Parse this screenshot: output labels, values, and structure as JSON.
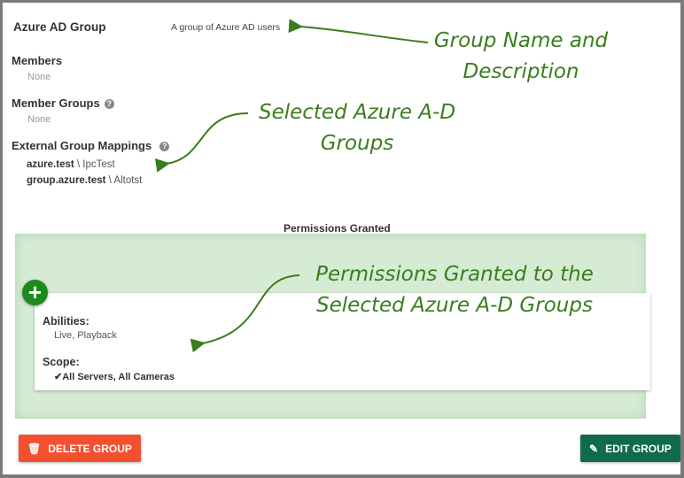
{
  "group": {
    "name": "Azure AD Group",
    "description": "A group of Azure AD users"
  },
  "members": {
    "label": "Members",
    "value": "None"
  },
  "member_groups": {
    "label": "Member Groups",
    "value": "None"
  },
  "external": {
    "label": "External Group Mappings",
    "mappings": [
      {
        "domain": "azure.test",
        "sep": " \\ ",
        "group": "IpcTest"
      },
      {
        "domain": "group.azure.test",
        "sep": " \\ ",
        "group": "Altotst"
      }
    ]
  },
  "permissions": {
    "title": "Permissions Granted",
    "abilities_label": "Abilities:",
    "abilities": "Live, Playback",
    "scope_label": "Scope:",
    "scope": "All Servers, All Cameras"
  },
  "buttons": {
    "delete": "DELETE GROUP",
    "edit": "EDIT GROUP"
  },
  "annotations": {
    "a1": "Group Name and Description",
    "a2": "Selected Azure A-D Groups",
    "a3": "Permissions Granted to the Selected Azure A-D Groups"
  },
  "colors": {
    "delete": "#f4502f",
    "edit": "#0f6b4b",
    "annotation": "#3a7d1e",
    "panel": "#d5ebd3"
  }
}
